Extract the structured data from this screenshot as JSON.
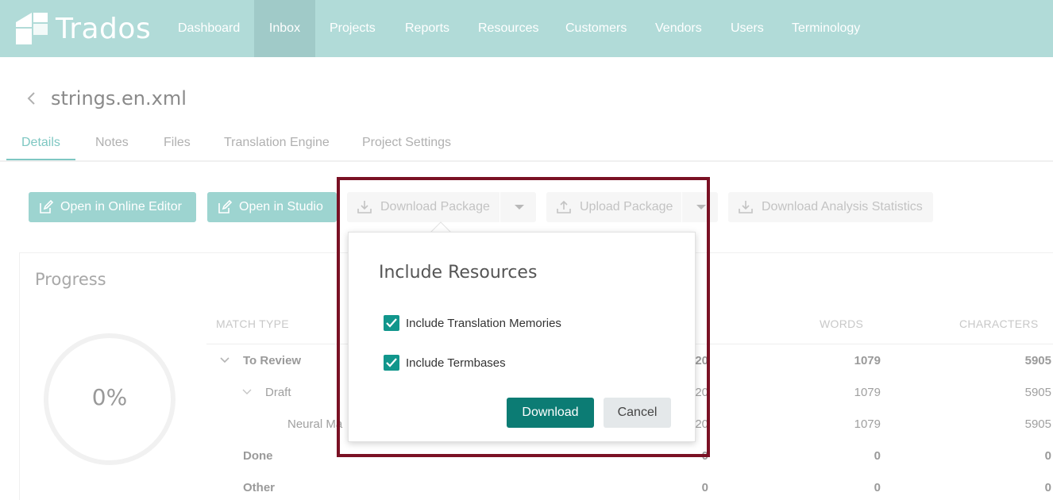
{
  "app": {
    "brand": "Trados",
    "nav": [
      "Dashboard",
      "Inbox",
      "Projects",
      "Reports",
      "Resources",
      "Customers",
      "Vendors",
      "Users",
      "Terminology"
    ],
    "active_nav": "Inbox",
    "colors": {
      "header": "#b1dbd8",
      "accent": "#11968c",
      "primary_button": "#0c7c74",
      "highlight": "#7a1124"
    }
  },
  "page": {
    "title": "strings.en.xml",
    "tabs": [
      "Details",
      "Notes",
      "Files",
      "Translation Engine",
      "Project Settings"
    ],
    "active_tab": "Details"
  },
  "toolbar": {
    "open_online_editor": "Open in Online Editor",
    "open_studio": "Open in Studio",
    "download_package": "Download Package",
    "upload_package": "Upload Package",
    "download_stats": "Download Analysis Statistics"
  },
  "progress": {
    "title": "Progress",
    "percent": "0%",
    "columns": {
      "match_type": "MATCH TYPE",
      "words": "WORDS",
      "characters": "CHARACTERS"
    },
    "rows": [
      {
        "label": "To Review",
        "segments": "20",
        "words": "1079",
        "characters": "5905"
      },
      {
        "label": "Draft",
        "segments": "20",
        "words": "1079",
        "characters": "5905"
      },
      {
        "label": "Neural Ma",
        "segments": "20",
        "words": "1079",
        "characters": "5905"
      },
      {
        "label": "Done",
        "segments": "0",
        "words": "0",
        "characters": "0"
      },
      {
        "label": "Other",
        "segments": "0",
        "words": "0",
        "characters": "0"
      }
    ]
  },
  "dialog": {
    "title": "Include Resources",
    "options": [
      {
        "label": "Include Translation Memories",
        "checked": true
      },
      {
        "label": "Include Termbases",
        "checked": true
      }
    ],
    "download": "Download",
    "cancel": "Cancel"
  }
}
